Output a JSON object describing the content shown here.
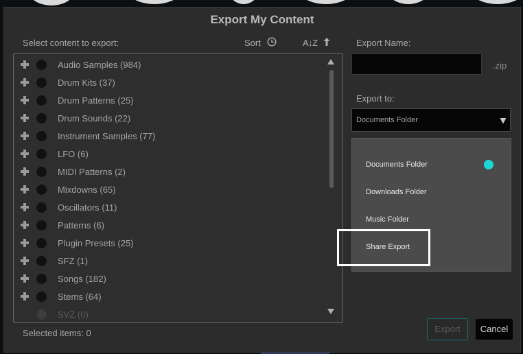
{
  "dialog": {
    "title": "Export My Content"
  },
  "content_list": {
    "label": "Select content to export:",
    "sort_label": "Sort",
    "az_label": "A↓Z",
    "items": [
      {
        "label": "Audio Samples (984)",
        "enabled": true
      },
      {
        "label": "Drum Kits (37)",
        "enabled": true
      },
      {
        "label": "Drum Patterns (25)",
        "enabled": true
      },
      {
        "label": "Drum Sounds (22)",
        "enabled": true
      },
      {
        "label": "Instrument Samples (77)",
        "enabled": true
      },
      {
        "label": "LFO (6)",
        "enabled": true
      },
      {
        "label": "MIDI Patterns (2)",
        "enabled": true
      },
      {
        "label": "Mixdowns (65)",
        "enabled": true
      },
      {
        "label": "Oscillators (11)",
        "enabled": true
      },
      {
        "label": "Patterns (6)",
        "enabled": true
      },
      {
        "label": "Plugin Presets (25)",
        "enabled": true
      },
      {
        "label": "SFZ (1)",
        "enabled": true
      },
      {
        "label": "Songs (182)",
        "enabled": true
      },
      {
        "label": "Stems (64)",
        "enabled": true
      },
      {
        "label": "SVZ (0)",
        "enabled": false
      }
    ],
    "selected_count": "Selected items: 0"
  },
  "export_name": {
    "label": "Export Name:",
    "value": "",
    "extension": ".zip"
  },
  "export_to": {
    "label": "Export to:",
    "selected": "Documents Folder",
    "options": [
      {
        "label": "Documents Folder",
        "selected": true
      },
      {
        "label": "Downloads Folder",
        "selected": false
      },
      {
        "label": "Music Folder",
        "selected": false
      },
      {
        "label": "Share Export",
        "selected": false
      }
    ],
    "accent_color": "#1ad7d4"
  },
  "buttons": {
    "export": "Export",
    "cancel": "Cancel"
  }
}
